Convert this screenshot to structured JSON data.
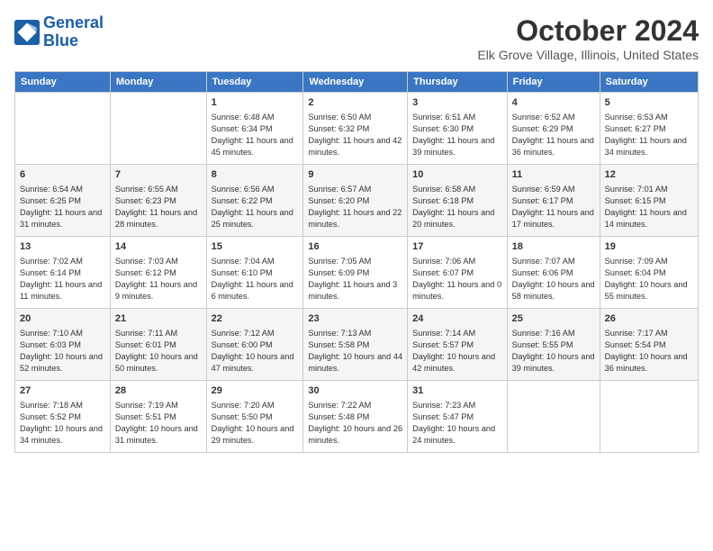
{
  "header": {
    "logo_line1": "General",
    "logo_line2": "Blue",
    "title": "October 2024",
    "subtitle": "Elk Grove Village, Illinois, United States"
  },
  "calendar": {
    "days_of_week": [
      "Sunday",
      "Monday",
      "Tuesday",
      "Wednesday",
      "Thursday",
      "Friday",
      "Saturday"
    ],
    "weeks": [
      [
        {
          "day": "",
          "detail": ""
        },
        {
          "day": "",
          "detail": ""
        },
        {
          "day": "1",
          "detail": "Sunrise: 6:48 AM\nSunset: 6:34 PM\nDaylight: 11 hours and 45 minutes."
        },
        {
          "day": "2",
          "detail": "Sunrise: 6:50 AM\nSunset: 6:32 PM\nDaylight: 11 hours and 42 minutes."
        },
        {
          "day": "3",
          "detail": "Sunrise: 6:51 AM\nSunset: 6:30 PM\nDaylight: 11 hours and 39 minutes."
        },
        {
          "day": "4",
          "detail": "Sunrise: 6:52 AM\nSunset: 6:29 PM\nDaylight: 11 hours and 36 minutes."
        },
        {
          "day": "5",
          "detail": "Sunrise: 6:53 AM\nSunset: 6:27 PM\nDaylight: 11 hours and 34 minutes."
        }
      ],
      [
        {
          "day": "6",
          "detail": "Sunrise: 6:54 AM\nSunset: 6:25 PM\nDaylight: 11 hours and 31 minutes."
        },
        {
          "day": "7",
          "detail": "Sunrise: 6:55 AM\nSunset: 6:23 PM\nDaylight: 11 hours and 28 minutes."
        },
        {
          "day": "8",
          "detail": "Sunrise: 6:56 AM\nSunset: 6:22 PM\nDaylight: 11 hours and 25 minutes."
        },
        {
          "day": "9",
          "detail": "Sunrise: 6:57 AM\nSunset: 6:20 PM\nDaylight: 11 hours and 22 minutes."
        },
        {
          "day": "10",
          "detail": "Sunrise: 6:58 AM\nSunset: 6:18 PM\nDaylight: 11 hours and 20 minutes."
        },
        {
          "day": "11",
          "detail": "Sunrise: 6:59 AM\nSunset: 6:17 PM\nDaylight: 11 hours and 17 minutes."
        },
        {
          "day": "12",
          "detail": "Sunrise: 7:01 AM\nSunset: 6:15 PM\nDaylight: 11 hours and 14 minutes."
        }
      ],
      [
        {
          "day": "13",
          "detail": "Sunrise: 7:02 AM\nSunset: 6:14 PM\nDaylight: 11 hours and 11 minutes."
        },
        {
          "day": "14",
          "detail": "Sunrise: 7:03 AM\nSunset: 6:12 PM\nDaylight: 11 hours and 9 minutes."
        },
        {
          "day": "15",
          "detail": "Sunrise: 7:04 AM\nSunset: 6:10 PM\nDaylight: 11 hours and 6 minutes."
        },
        {
          "day": "16",
          "detail": "Sunrise: 7:05 AM\nSunset: 6:09 PM\nDaylight: 11 hours and 3 minutes."
        },
        {
          "day": "17",
          "detail": "Sunrise: 7:06 AM\nSunset: 6:07 PM\nDaylight: 11 hours and 0 minutes."
        },
        {
          "day": "18",
          "detail": "Sunrise: 7:07 AM\nSunset: 6:06 PM\nDaylight: 10 hours and 58 minutes."
        },
        {
          "day": "19",
          "detail": "Sunrise: 7:09 AM\nSunset: 6:04 PM\nDaylight: 10 hours and 55 minutes."
        }
      ],
      [
        {
          "day": "20",
          "detail": "Sunrise: 7:10 AM\nSunset: 6:03 PM\nDaylight: 10 hours and 52 minutes."
        },
        {
          "day": "21",
          "detail": "Sunrise: 7:11 AM\nSunset: 6:01 PM\nDaylight: 10 hours and 50 minutes."
        },
        {
          "day": "22",
          "detail": "Sunrise: 7:12 AM\nSunset: 6:00 PM\nDaylight: 10 hours and 47 minutes."
        },
        {
          "day": "23",
          "detail": "Sunrise: 7:13 AM\nSunset: 5:58 PM\nDaylight: 10 hours and 44 minutes."
        },
        {
          "day": "24",
          "detail": "Sunrise: 7:14 AM\nSunset: 5:57 PM\nDaylight: 10 hours and 42 minutes."
        },
        {
          "day": "25",
          "detail": "Sunrise: 7:16 AM\nSunset: 5:55 PM\nDaylight: 10 hours and 39 minutes."
        },
        {
          "day": "26",
          "detail": "Sunrise: 7:17 AM\nSunset: 5:54 PM\nDaylight: 10 hours and 36 minutes."
        }
      ],
      [
        {
          "day": "27",
          "detail": "Sunrise: 7:18 AM\nSunset: 5:52 PM\nDaylight: 10 hours and 34 minutes."
        },
        {
          "day": "28",
          "detail": "Sunrise: 7:19 AM\nSunset: 5:51 PM\nDaylight: 10 hours and 31 minutes."
        },
        {
          "day": "29",
          "detail": "Sunrise: 7:20 AM\nSunset: 5:50 PM\nDaylight: 10 hours and 29 minutes."
        },
        {
          "day": "30",
          "detail": "Sunrise: 7:22 AM\nSunset: 5:48 PM\nDaylight: 10 hours and 26 minutes."
        },
        {
          "day": "31",
          "detail": "Sunrise: 7:23 AM\nSunset: 5:47 PM\nDaylight: 10 hours and 24 minutes."
        },
        {
          "day": "",
          "detail": ""
        },
        {
          "day": "",
          "detail": ""
        }
      ]
    ]
  }
}
